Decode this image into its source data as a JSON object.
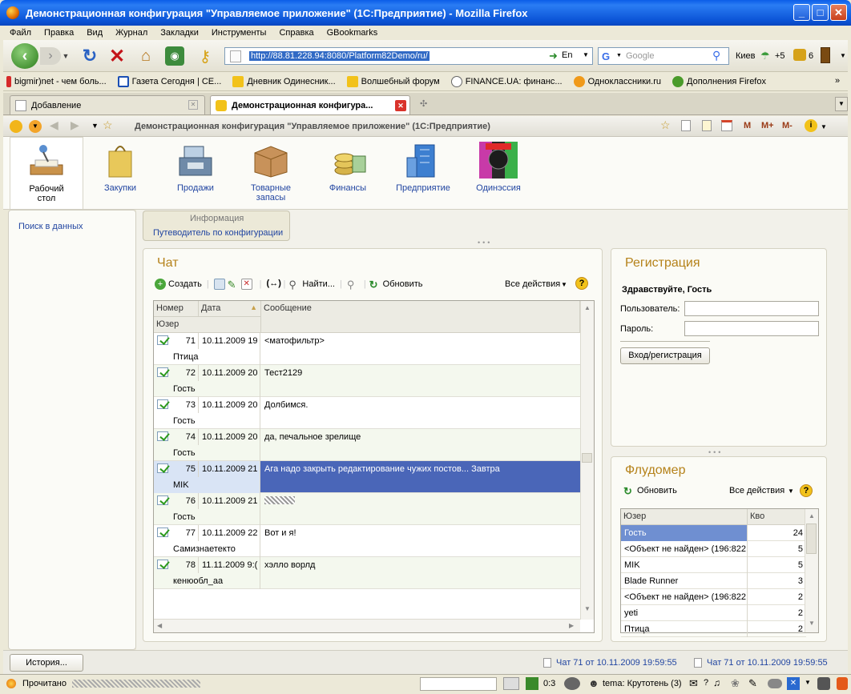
{
  "window": {
    "title": "Демонстрационная конфигурация \"Управляемое приложение\" (1С:Предприятие) - Mozilla Firefox"
  },
  "menu": [
    "Файл",
    "Правка",
    "Вид",
    "Журнал",
    "Закладки",
    "Инструменты",
    "Справка",
    "GBookmarks"
  ],
  "nav": {
    "url": "http://88.81.228.94:8080/Platform82Demo/ru/",
    "lang": "En",
    "search_placeholder": "Google",
    "city": "Киев",
    "temp": "+5",
    "count": "6"
  },
  "bookmarks": [
    "bigmir)net - чем боль...",
    "Газета Сегодня | СЕ...",
    "Дневник Одинесник...",
    "Волшебный форум",
    "FINANCE.UA: финанс...",
    "Одноклассники.ru",
    "Дополнения Firefox"
  ],
  "tabs": [
    "Добавление",
    "Демонстрационная конфигура..."
  ],
  "app": {
    "title": "Демонстрационная конфигурация \"Управляемое приложение\" (1С:Предприятие)",
    "m": "M",
    "mplus": "M+",
    "mminus": "M-"
  },
  "sections": [
    {
      "label": "Рабочий стол"
    },
    {
      "label": "Закупки"
    },
    {
      "label": "Продажи"
    },
    {
      "label": "Товарные запасы"
    },
    {
      "label": "Финансы"
    },
    {
      "label": "Предприятие"
    },
    {
      "label": "Одинэссия"
    }
  ],
  "left": {
    "search_link": "Поиск в данных"
  },
  "info": {
    "header": "Информация",
    "link": "Путеводитель по конфигурации"
  },
  "chat": {
    "title": "Чат",
    "create": "Создать",
    "find": "Найти...",
    "refresh": "Обновить",
    "all_actions": "Все действия",
    "col_num": "Номер",
    "col_date": "Дата",
    "col_msg": "Сообщение",
    "col_user": "Юзер",
    "rows": [
      {
        "num": "71",
        "date": "10.11.2009 19",
        "msg": "<матофильтр>",
        "user": "Птица"
      },
      {
        "num": "72",
        "date": "10.11.2009 20",
        "msg": "Тест2129",
        "user": "Гость"
      },
      {
        "num": "73",
        "date": "10.11.2009 20",
        "msg": "Долбимся.",
        "user": "Гость"
      },
      {
        "num": "74",
        "date": "10.11.2009 20",
        "msg": "да, печальное зрелище",
        "user": "Гость"
      },
      {
        "num": "75",
        "date": "10.11.2009 21",
        "msg": "Ага надо закрыть редактирование чужих постов... Завтра",
        "user": "MIK"
      },
      {
        "num": "76",
        "date": "10.11.2009 21",
        "msg": "",
        "user": "Гость"
      },
      {
        "num": "77",
        "date": "10.11.2009 22",
        "msg": "Вот и я!",
        "user": "Самизнаетекто"
      },
      {
        "num": "78",
        "date": "11.11.2009 9:(",
        "msg": "хэлло ворлд",
        "user": "кенюобл_аа"
      }
    ]
  },
  "reg": {
    "title": "Регистрация",
    "greeting": "Здравствуйте, Гость",
    "user_label": "Пользователь:",
    "pass_label": "Пароль:",
    "button": "Вход/регистрация"
  },
  "flood": {
    "title": "Флудомер",
    "refresh": "Обновить",
    "all_actions": "Все действия",
    "col_user": "Юзер",
    "col_count": "Кво",
    "rows": [
      {
        "user": "Гость",
        "count": "24"
      },
      {
        "user": "<Объект не найден> (196:822",
        "count": "5"
      },
      {
        "user": "MIK",
        "count": "5"
      },
      {
        "user": "Blade Runner",
        "count": "3"
      },
      {
        "user": "<Объект не найден> (196:822",
        "count": "2"
      },
      {
        "user": "yeti",
        "count": "2"
      },
      {
        "user": "Птица",
        "count": "2"
      }
    ]
  },
  "bottom": {
    "history": "История...",
    "note1": "Чат 71 от 10.11.2009 19:59:55",
    "note2": "Чат 71 от 10.11.2009 19:59:55"
  },
  "status": {
    "left": "Прочитано",
    "counter": "0:3",
    "tema": "tema: Крутотень (3)"
  }
}
